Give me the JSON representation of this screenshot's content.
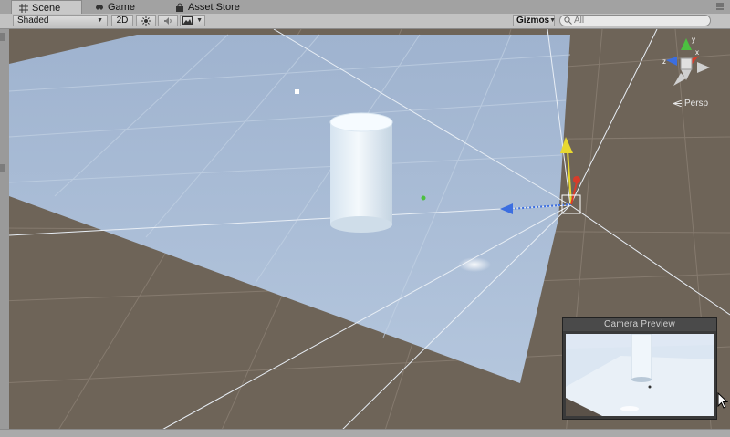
{
  "tabs": [
    {
      "label": "Scene",
      "icon": "scene-grid-icon",
      "active": true
    },
    {
      "label": "Game",
      "icon": "game-controller-icon",
      "active": false
    },
    {
      "label": "Asset Store",
      "icon": "asset-store-bag-icon",
      "active": false
    }
  ],
  "toolbar": {
    "draw_mode": "Shaded",
    "mode_2d": "2D",
    "lighting_icon": "sun-icon",
    "audio_icon": "speaker-icon",
    "effects_icon": "image-effects-icon",
    "gizmos_label": "Gizmos",
    "search_placeholder": "All"
  },
  "scene": {
    "projection_label": "Persp",
    "axis_labels": {
      "x": "x",
      "y": "y",
      "z": "z"
    },
    "colors": {
      "ground": "#6e6458",
      "plane": "#a8bcd8",
      "cylinder": "#e8f1f8",
      "axis_x": "#d83c2a",
      "axis_y": "#e8d830",
      "axis_z": "#3c6ee0",
      "gizmo_green": "#4cc040"
    }
  },
  "camera_preview": {
    "title": "Camera Preview"
  }
}
